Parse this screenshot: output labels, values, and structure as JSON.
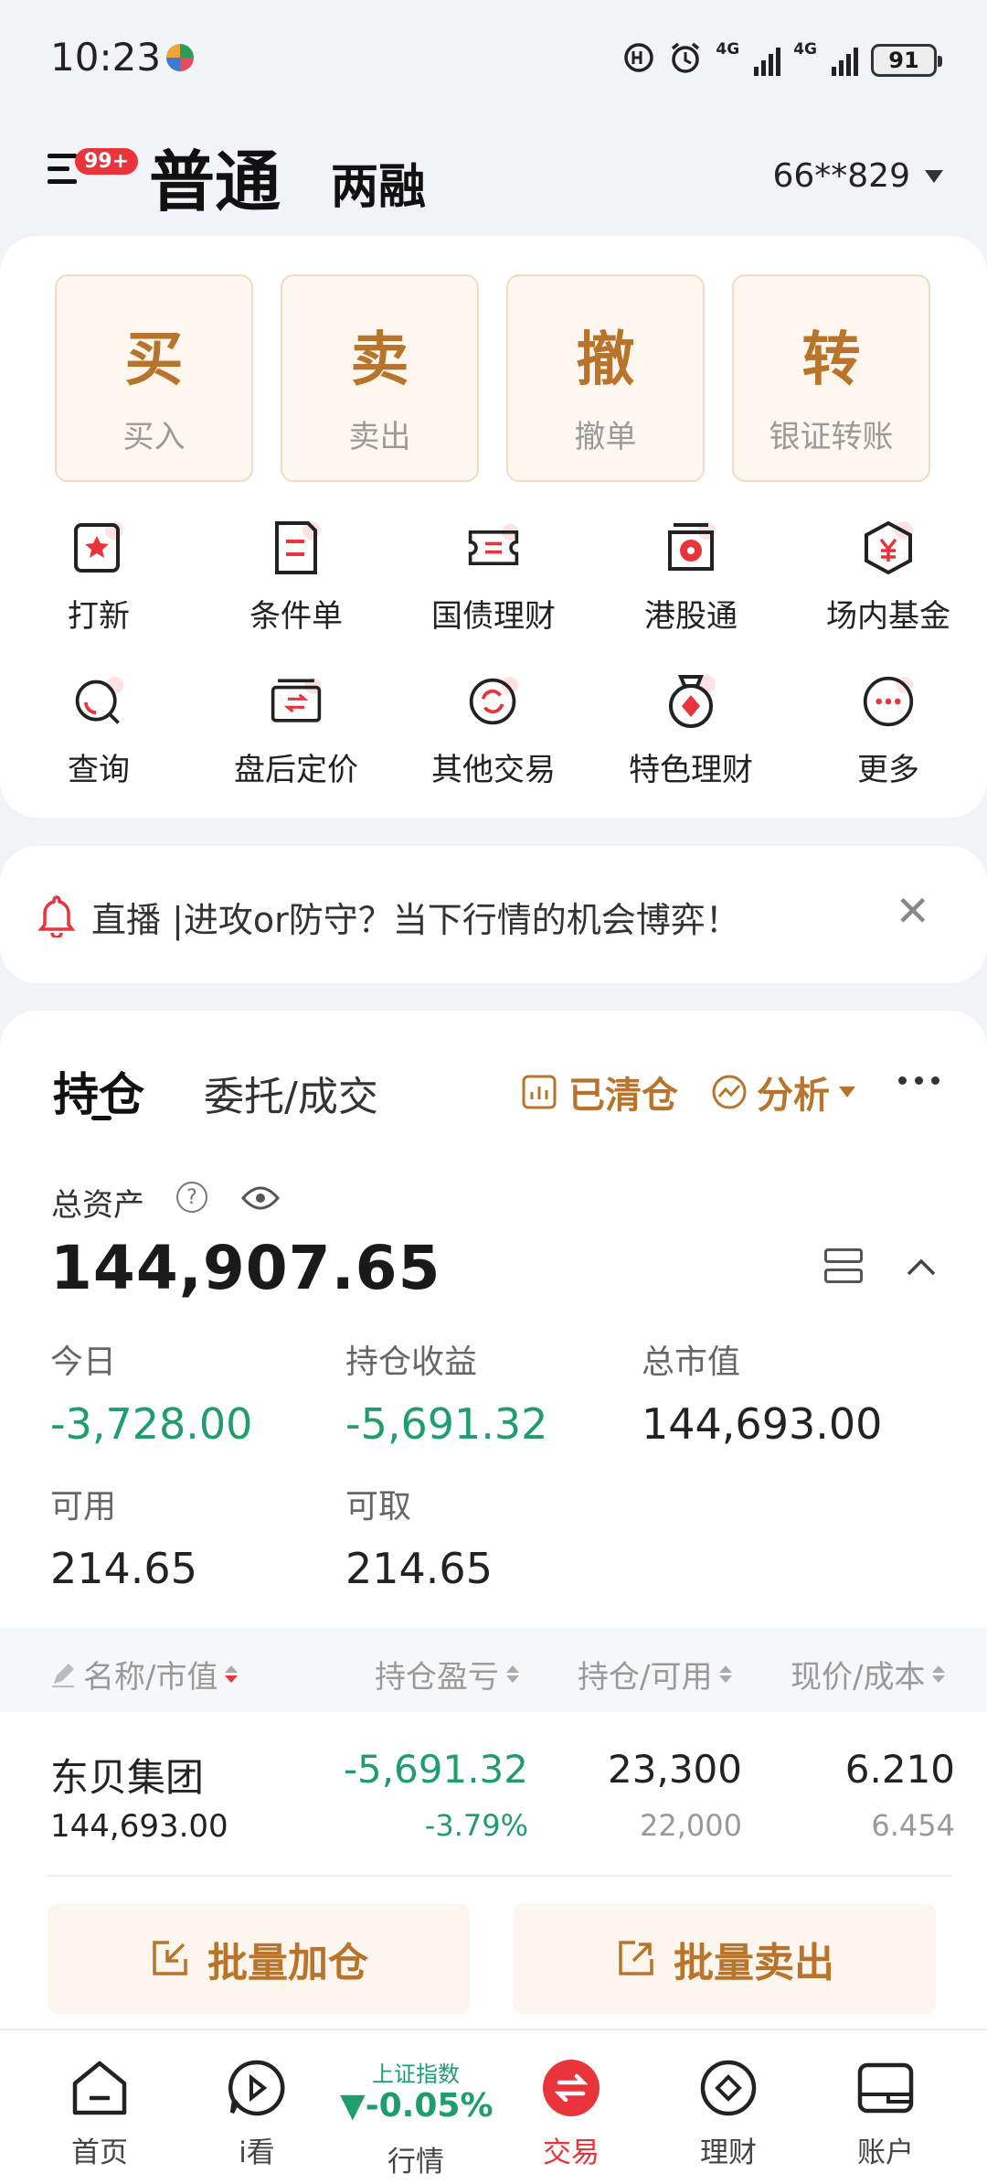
{
  "status_bar": {
    "time": "10:23",
    "net1": "4G",
    "net2": "4G",
    "battery": "91"
  },
  "header": {
    "badge": "99+",
    "tab_normal": "普通",
    "tab_margin": "两融",
    "account": "66**829"
  },
  "trade_buttons": [
    {
      "big": "买",
      "small": "买入"
    },
    {
      "big": "卖",
      "small": "卖出"
    },
    {
      "big": "撤",
      "small": "撤单"
    },
    {
      "big": "转",
      "small": "银证转账"
    }
  ],
  "grid": {
    "row1": [
      "打新",
      "条件单",
      "国债理财",
      "港股通",
      "场内基金"
    ],
    "row2": [
      "查询",
      "盘后定价",
      "其他交易",
      "特色理财",
      "更多"
    ]
  },
  "banner": {
    "text": "直播 |进攻or防守？当下行情的机会博弈！"
  },
  "positions": {
    "tab_active": "持仓",
    "tab_other": "委托/成交",
    "cleared": "已清仓",
    "analysis": "分析",
    "total_assets_label": "总资产",
    "total_assets": "144,907.65",
    "stats": {
      "today_label": "今日",
      "today": "-3,728.00",
      "profit_label": "持仓收益",
      "profit": "-5,691.32",
      "market_value_label": "总市值",
      "market_value": "144,693.00",
      "available_label": "可用",
      "available": "214.65",
      "withdrawable_label": "可取",
      "withdrawable": "214.65"
    },
    "columns": [
      "名称/市值",
      "持仓盈亏",
      "持仓/可用",
      "现价/成本"
    ],
    "rows": [
      {
        "name": "东贝集团",
        "market_value": "144,693.00",
        "pnl": "-5,691.32",
        "pnl_pct": "-3.79%",
        "holding": "23,300",
        "available": "22,000",
        "price": "6.210",
        "cost": "6.454"
      }
    ],
    "batch_add": "批量加仓",
    "batch_sell": "批量卖出"
  },
  "bottom_nav": {
    "home": "首页",
    "watch": "i看",
    "index_name": "上证指数",
    "index_value": "-0.05%",
    "market": "行情",
    "trade": "交易",
    "finance": "理财",
    "account": "账户"
  },
  "colors": {
    "accent_gold": "#b8742a",
    "loss_green": "#1f9d6a",
    "brand_red": "#e8343a"
  }
}
